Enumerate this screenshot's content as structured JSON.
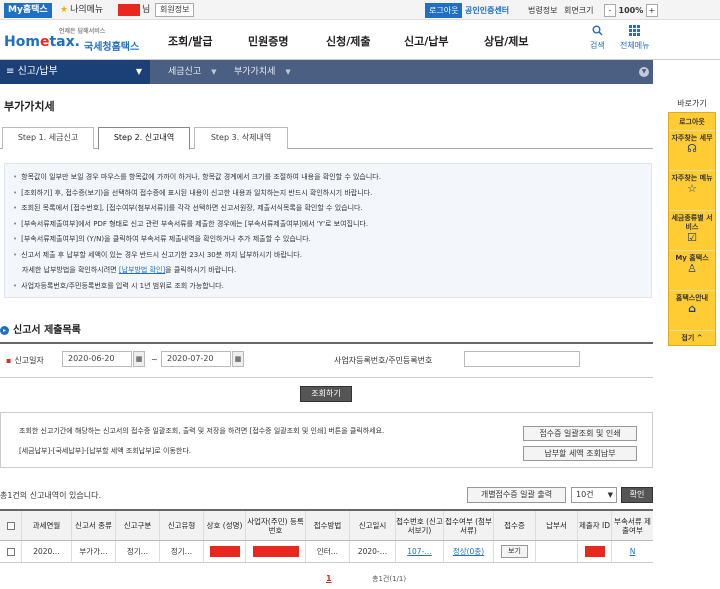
{
  "topbar": {
    "brand": "My홈택스",
    "favorites": "나의메뉴",
    "user_suffix": "님",
    "member_info": "회원정보",
    "logout": "로그아웃",
    "cert_center": "공인인증센터",
    "law_info": "법령정보",
    "screen_size": "회면크기",
    "zoom_minus": "-",
    "zoom_level": "100%",
    "zoom_plus": "+"
  },
  "header": {
    "logo_small": "언제든 답해서비스",
    "logo_main_a": "Hom",
    "logo_main_b": "e",
    "logo_main_c": "tax.",
    "logo_ko": "국세청홈택스",
    "gnb": [
      "조회/발급",
      "민원증명",
      "신청/제출",
      "신고/납부",
      "상담/제보"
    ],
    "search_label": "검색",
    "allmenu_label": "전체메뉴"
  },
  "navbar": {
    "menu": "신고/납부",
    "crumb1": "세금신고",
    "crumb2": "부가가치세"
  },
  "quick": {
    "title": "바로가기",
    "logout": "로그아웃",
    "items": [
      {
        "label": "자주찾는 세무",
        "icon": "ai-headset-icon"
      },
      {
        "label": "자주찾는 메뉴",
        "icon": "star-icon"
      },
      {
        "label": "세금종류별 서비스",
        "icon": "check-icon"
      },
      {
        "label": "My 홈택스",
        "icon": "person-icon"
      },
      {
        "label": "홈택스안내",
        "icon": "guide-icon"
      }
    ],
    "collapse": "접기 ^"
  },
  "page": {
    "title": "부가가치세",
    "tabs": [
      "Step 1. 세금신고",
      "Step 2. 신고내역",
      "Step 3. 삭제내역"
    ],
    "active_tab": 1
  },
  "notice": {
    "lines": [
      "항목값이 일부만 보일 경우 마우스를 항목값에 가까이 하거나, 항목값 경계에서 크기를 조절하여 내용을 확인할 수 있습니다.",
      "[조회하기] 후, 접수증(보기)을 선택하여 접수증에 표시된 내용이 신고한 내용과 일치하는지 반드시 확인하시기 바랍니다.",
      "조회된 목록에서 [접수번호], [접수여부(첨부서류)]를 각각 선택하면 신고서원장, 제출서식목록을 확인할 수 있습니다.",
      "[부속서류제출여부]에서 PDF 형태로 신고 관련 부속서류를 제출한 경우에는 [부속서류제출여부]에서 'Y'로 보여집니다.",
      "[부속서류제출여부]의 (Y/N)을 클릭하여 부속서류 제출내역을 확인하거나 추가 제출할 수 있습니다.",
      "신고서 제출 후 납부할 세액이 있는 경우 반드시 신고기한 23시 30분 까지 납부하시기 바랍니다."
    ],
    "cont_before": "자세한 납부방법을 확인하시려면 ",
    "cont_link": "[납부방법 확인]",
    "cont_after": "을 클릭하시기 바랍니다.",
    "last_line": "사업자등록번호/주민등록번호를 입력 시 1년 범위로 조회 가능합니다."
  },
  "section": {
    "title": "신고서 제출목록",
    "period_label": "신고일자",
    "date_from": "2020-06-20",
    "date_to": "2020-07-20",
    "tilde": "~",
    "biz_label": "사업자등록번호/주민등록번호",
    "search_button": "조회하기"
  },
  "info": {
    "line1": "조회한 신고기간에 해당하는 신고서의 접수증 일괄조회, 출력 및 저장을 하려면 [접수증 일괄조회 및 인쇄] 버튼을 클릭하세요.",
    "line2": "[세금납부]-[국세납부]-[납부할 세액 조회납부]로 이동한다.",
    "bulk_button": "접수증 일괄조회 및 인쇄",
    "pay_button": "납부할 세액 조회납부"
  },
  "results": {
    "count_text": "총1건의 신고내역이 있습니다.",
    "bulk_button": "개별접수증 일괄 출력",
    "page_size": "10건",
    "confirm_button": "확인",
    "columns": [
      "과세연월",
      "신고서 종류",
      "신고구분",
      "신고유형",
      "상호 (성명)",
      "사업자(주민) 등록번호",
      "접수방법",
      "신고일시",
      "접수번호 (신고서보기)",
      "접수여부 (첨부서류)",
      "접수증",
      "납부서",
      "제출자 ID",
      "부속서류 제출여부"
    ],
    "row": {
      "period": "2020…",
      "form": "부가가…",
      "category": "정기…",
      "type": "정기…",
      "method": "인터…",
      "date": "2020-…",
      "receipt_no": "107-…",
      "status": "정상(0종)",
      "receipt_btn": "보기",
      "attach": "N"
    },
    "page_current": "1",
    "page_info": "총1건(1/1)"
  },
  "colors": {
    "primary": "#1f6fc4",
    "nav": "#4a5f82",
    "quick": "#ffcc33",
    "redact": "#e8281e"
  }
}
